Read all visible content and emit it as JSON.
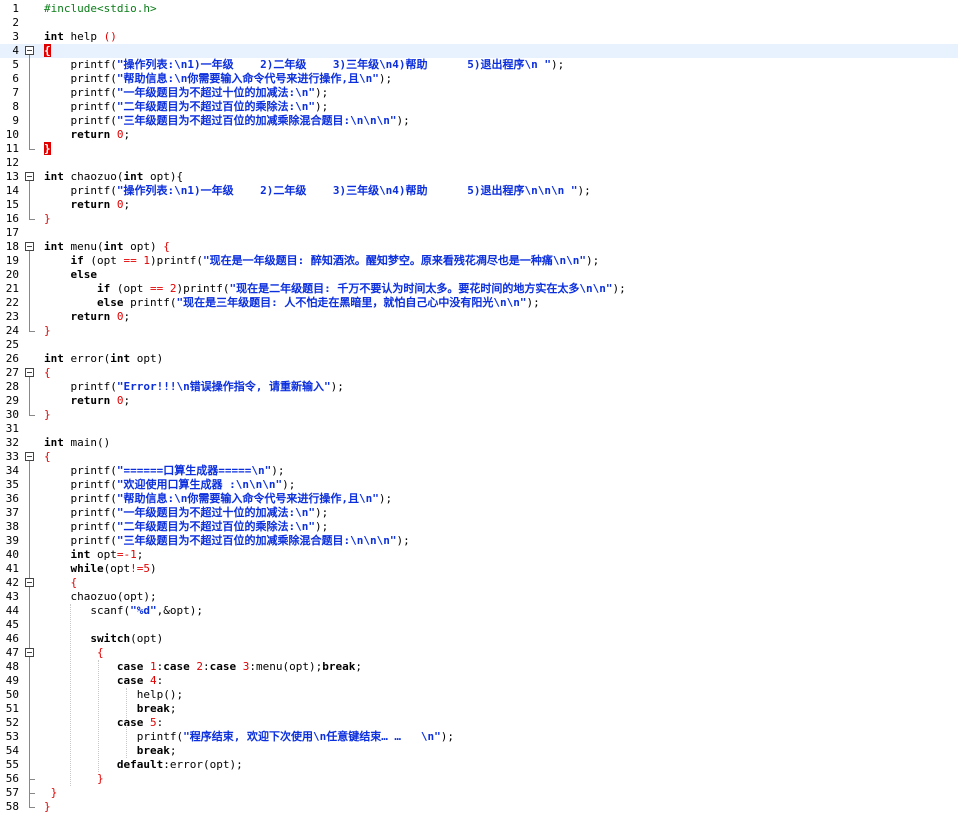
{
  "editor": {
    "current_line": 4,
    "lines": [
      {
        "n": "1",
        "t": [
          [
            "pp",
            "#include<stdio.h>"
          ]
        ]
      },
      {
        "n": "2",
        "t": []
      },
      {
        "n": "3",
        "t": [
          [
            "kw",
            "int"
          ],
          [
            "id",
            " help "
          ],
          [
            "op",
            "()"
          ]
        ]
      },
      {
        "n": "4",
        "t": [
          [
            "br",
            "{"
          ]
        ]
      },
      {
        "n": "5",
        "t": [
          [
            "id",
            "    printf("
          ],
          [
            "str",
            "\"操作列表:\\n1)一年级    2)二年级    3)三年级\\n4)帮助      5)退出程序\\n \""
          ],
          [
            "id",
            ");"
          ]
        ]
      },
      {
        "n": "6",
        "t": [
          [
            "id",
            "    printf("
          ],
          [
            "str",
            "\"帮助信息:\\n你需要输入命令代号来进行操作,且\\n\""
          ],
          [
            "id",
            ");"
          ]
        ]
      },
      {
        "n": "7",
        "t": [
          [
            "id",
            "    printf("
          ],
          [
            "str",
            "\"一年级题目为不超过十位的加减法:\\n\""
          ],
          [
            "id",
            ");"
          ]
        ]
      },
      {
        "n": "8",
        "t": [
          [
            "id",
            "    printf("
          ],
          [
            "str",
            "\"二年级题目为不超过百位的乘除法:\\n\""
          ],
          [
            "id",
            ");"
          ]
        ]
      },
      {
        "n": "9",
        "t": [
          [
            "id",
            "    printf("
          ],
          [
            "str",
            "\"三年级题目为不超过百位的加减乘除混合题目:\\n\\n\\n\""
          ],
          [
            "id",
            ");"
          ]
        ]
      },
      {
        "n": "10",
        "t": [
          [
            "id",
            "    "
          ],
          [
            "kw",
            "return"
          ],
          [
            "id",
            " "
          ],
          [
            "num",
            "0"
          ],
          [
            "id",
            ";"
          ]
        ]
      },
      {
        "n": "11",
        "t": [
          [
            "br",
            "}"
          ]
        ]
      },
      {
        "n": "12",
        "t": []
      },
      {
        "n": "13",
        "t": [
          [
            "kw",
            "int"
          ],
          [
            "id",
            " chaozuo("
          ],
          [
            "kw",
            "int"
          ],
          [
            "id",
            " opt){"
          ]
        ]
      },
      {
        "n": "14",
        "t": [
          [
            "id",
            "    printf("
          ],
          [
            "str",
            "\"操作列表:\\n1)一年级    2)二年级    3)三年级\\n4)帮助      5)退出程序\\n\\n\\n \""
          ],
          [
            "id",
            ");"
          ]
        ]
      },
      {
        "n": "15",
        "t": [
          [
            "id",
            "    "
          ],
          [
            "kw",
            "return"
          ],
          [
            "id",
            " "
          ],
          [
            "num",
            "0"
          ],
          [
            "id",
            ";"
          ]
        ]
      },
      {
        "n": "16",
        "t": [
          [
            "op",
            "}"
          ]
        ]
      },
      {
        "n": "17",
        "t": []
      },
      {
        "n": "18",
        "t": [
          [
            "kw",
            "int"
          ],
          [
            "id",
            " menu("
          ],
          [
            "kw",
            "int"
          ],
          [
            "id",
            " opt) "
          ],
          [
            "op",
            "{"
          ]
        ]
      },
      {
        "n": "19",
        "t": [
          [
            "id",
            "    "
          ],
          [
            "kw",
            "if"
          ],
          [
            "id",
            " (opt "
          ],
          [
            "op",
            "=="
          ],
          [
            "id",
            " "
          ],
          [
            "num",
            "1"
          ],
          [
            "id",
            ")printf("
          ],
          [
            "str",
            "\"现在是一年级题目: 醉知酒浓。醒知梦空。原来看残花凋尽也是一种痛\\n\\n\""
          ],
          [
            "id",
            ");"
          ]
        ]
      },
      {
        "n": "20",
        "t": [
          [
            "id",
            "    "
          ],
          [
            "kw",
            "else"
          ]
        ]
      },
      {
        "n": "21",
        "t": [
          [
            "id",
            "        "
          ],
          [
            "kw",
            "if"
          ],
          [
            "id",
            " (opt "
          ],
          [
            "op",
            "=="
          ],
          [
            "id",
            " "
          ],
          [
            "num",
            "2"
          ],
          [
            "id",
            ")printf("
          ],
          [
            "str",
            "\"现在是二年级题目: 千万不要认为时间太多。要花时间的地方实在太多\\n\\n\""
          ],
          [
            "id",
            ");"
          ]
        ]
      },
      {
        "n": "22",
        "t": [
          [
            "id",
            "        "
          ],
          [
            "kw",
            "else"
          ],
          [
            "id",
            " printf("
          ],
          [
            "str",
            "\"现在是三年级题目: 人不怕走在黑暗里，就怕自己心中没有阳光\\n\\n\""
          ],
          [
            "id",
            ");"
          ]
        ]
      },
      {
        "n": "23",
        "t": [
          [
            "id",
            "    "
          ],
          [
            "kw",
            "return"
          ],
          [
            "id",
            " "
          ],
          [
            "num",
            "0"
          ],
          [
            "id",
            ";"
          ]
        ]
      },
      {
        "n": "24",
        "t": [
          [
            "op",
            "}"
          ]
        ]
      },
      {
        "n": "25",
        "t": []
      },
      {
        "n": "26",
        "t": [
          [
            "kw",
            "int"
          ],
          [
            "id",
            " error("
          ],
          [
            "kw",
            "int"
          ],
          [
            "id",
            " opt)"
          ]
        ]
      },
      {
        "n": "27",
        "t": [
          [
            "op",
            "{"
          ]
        ]
      },
      {
        "n": "28",
        "t": [
          [
            "id",
            "    printf("
          ],
          [
            "str",
            "\"Error!!!\\n错误操作指令, 请重新输入\""
          ],
          [
            "id",
            ");"
          ]
        ]
      },
      {
        "n": "29",
        "t": [
          [
            "id",
            "    "
          ],
          [
            "kw",
            "return"
          ],
          [
            "id",
            " "
          ],
          [
            "num",
            "0"
          ],
          [
            "id",
            ";"
          ]
        ]
      },
      {
        "n": "30",
        "t": [
          [
            "op",
            "}"
          ]
        ]
      },
      {
        "n": "31",
        "t": []
      },
      {
        "n": "32",
        "t": [
          [
            "kw",
            "int"
          ],
          [
            "id",
            " main()"
          ]
        ]
      },
      {
        "n": "33",
        "t": [
          [
            "op",
            "{"
          ]
        ]
      },
      {
        "n": "34",
        "t": [
          [
            "id",
            "    printf("
          ],
          [
            "str",
            "\"======口算生成器=====\\n\""
          ],
          [
            "id",
            ");"
          ]
        ]
      },
      {
        "n": "35",
        "t": [
          [
            "id",
            "    printf("
          ],
          [
            "str",
            "\"欢迎使用口算生成器 :\\n\\n\\n\""
          ],
          [
            "id",
            ");"
          ]
        ]
      },
      {
        "n": "36",
        "t": [
          [
            "id",
            "    printf("
          ],
          [
            "str",
            "\"帮助信息:\\n你需要输入命令代号来进行操作,且\\n\""
          ],
          [
            "id",
            ");"
          ]
        ]
      },
      {
        "n": "37",
        "t": [
          [
            "id",
            "    printf("
          ],
          [
            "str",
            "\"一年级题目为不超过十位的加减法:\\n\""
          ],
          [
            "id",
            ");"
          ]
        ]
      },
      {
        "n": "38",
        "t": [
          [
            "id",
            "    printf("
          ],
          [
            "str",
            "\"二年级题目为不超过百位的乘除法:\\n\""
          ],
          [
            "id",
            ");"
          ]
        ]
      },
      {
        "n": "39",
        "t": [
          [
            "id",
            "    printf("
          ],
          [
            "str",
            "\"三年级题目为不超过百位的加减乘除混合题目:\\n\\n\\n\""
          ],
          [
            "id",
            ");"
          ]
        ]
      },
      {
        "n": "40",
        "t": [
          [
            "id",
            "    "
          ],
          [
            "kw",
            "int"
          ],
          [
            "id",
            " opt"
          ],
          [
            "op",
            "=-"
          ],
          [
            "num",
            "1"
          ],
          [
            "id",
            ";"
          ]
        ]
      },
      {
        "n": "41",
        "t": [
          [
            "id",
            "    "
          ],
          [
            "kw",
            "while"
          ],
          [
            "id",
            "(opt"
          ],
          [
            "op",
            "!="
          ],
          [
            "num",
            "5"
          ],
          [
            "id",
            ")"
          ]
        ]
      },
      {
        "n": "42",
        "t": [
          [
            "id",
            "    "
          ],
          [
            "op",
            "{"
          ]
        ]
      },
      {
        "n": "43",
        "t": [
          [
            "id",
            "    chaozuo(opt);"
          ]
        ]
      },
      {
        "n": "44",
        "t": [
          [
            "id",
            "       scanf("
          ],
          [
            "str",
            "\"%d\""
          ],
          [
            "id",
            ",&opt);"
          ]
        ]
      },
      {
        "n": "45",
        "t": []
      },
      {
        "n": "46",
        "t": [
          [
            "id",
            "       "
          ],
          [
            "kw",
            "switch"
          ],
          [
            "id",
            "(opt)"
          ]
        ]
      },
      {
        "n": "47",
        "t": [
          [
            "id",
            "        "
          ],
          [
            "op",
            "{"
          ]
        ]
      },
      {
        "n": "48",
        "t": [
          [
            "id",
            "           "
          ],
          [
            "kw",
            "case"
          ],
          [
            "id",
            " "
          ],
          [
            "num",
            "1"
          ],
          [
            "id",
            ":"
          ],
          [
            "kw",
            "case"
          ],
          [
            "id",
            " "
          ],
          [
            "num",
            "2"
          ],
          [
            "id",
            ":"
          ],
          [
            "kw",
            "case"
          ],
          [
            "id",
            " "
          ],
          [
            "num",
            "3"
          ],
          [
            "id",
            ":menu(opt);"
          ],
          [
            "kw",
            "break"
          ],
          [
            "id",
            ";"
          ]
        ]
      },
      {
        "n": "49",
        "t": [
          [
            "id",
            "           "
          ],
          [
            "kw",
            "case"
          ],
          [
            "id",
            " "
          ],
          [
            "num",
            "4"
          ],
          [
            "id",
            ":"
          ]
        ]
      },
      {
        "n": "50",
        "t": [
          [
            "id",
            "              help();"
          ]
        ]
      },
      {
        "n": "51",
        "t": [
          [
            "id",
            "              "
          ],
          [
            "kw",
            "break"
          ],
          [
            "id",
            ";"
          ]
        ]
      },
      {
        "n": "52",
        "t": [
          [
            "id",
            "           "
          ],
          [
            "kw",
            "case"
          ],
          [
            "id",
            " "
          ],
          [
            "num",
            "5"
          ],
          [
            "id",
            ":"
          ]
        ]
      },
      {
        "n": "53",
        "t": [
          [
            "id",
            "              printf("
          ],
          [
            "str",
            "\"程序结束, 欢迎下次使用\\n任意键结束… …   \\n\""
          ],
          [
            "id",
            ");"
          ]
        ]
      },
      {
        "n": "54",
        "t": [
          [
            "id",
            "              "
          ],
          [
            "kw",
            "break"
          ],
          [
            "id",
            ";"
          ]
        ]
      },
      {
        "n": "55",
        "t": [
          [
            "id",
            "           "
          ],
          [
            "kw",
            "default"
          ],
          [
            "id",
            ":error(opt);"
          ]
        ]
      },
      {
        "n": "56",
        "t": [
          [
            "id",
            "        "
          ],
          [
            "op",
            "}"
          ]
        ]
      },
      {
        "n": "57",
        "t": [
          [
            "id",
            " "
          ],
          [
            "op",
            "}"
          ]
        ]
      },
      {
        "n": "58",
        "t": [
          [
            "op",
            "}"
          ]
        ]
      }
    ]
  }
}
